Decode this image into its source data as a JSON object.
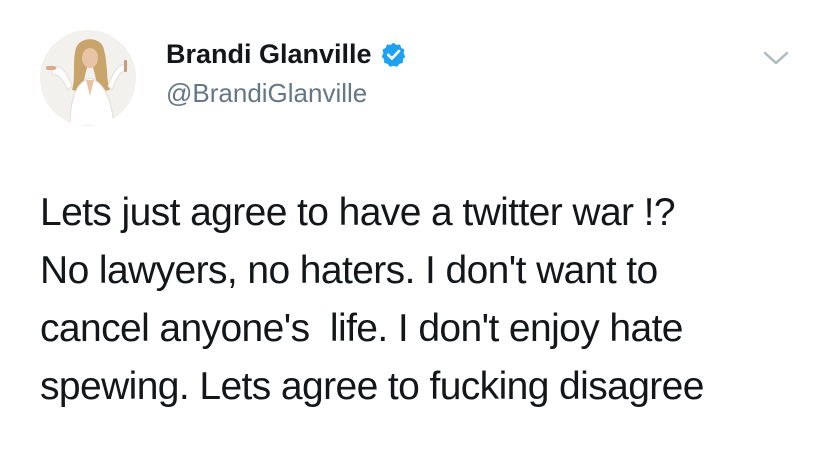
{
  "author": {
    "display_name": "Brandi Glanville",
    "handle": "@BrandiGlanville",
    "verified": true,
    "verified_icon": "verified-badge-icon",
    "avatar_icon": "profile-photo"
  },
  "controls": {
    "menu_icon": "chevron-down-icon"
  },
  "tweet": {
    "lines": [
      "Lets just agree to have a twitter war !?",
      "No lawyers, no haters. I don't want to",
      "cancel anyone's  life. I don't enjoy hate",
      "spewing. Lets agree to fucking disagree"
    ]
  },
  "colors": {
    "text": "#14171a",
    "secondary_text": "#657786",
    "verified_blue": "#1da1f2",
    "background": "#ffffff"
  }
}
